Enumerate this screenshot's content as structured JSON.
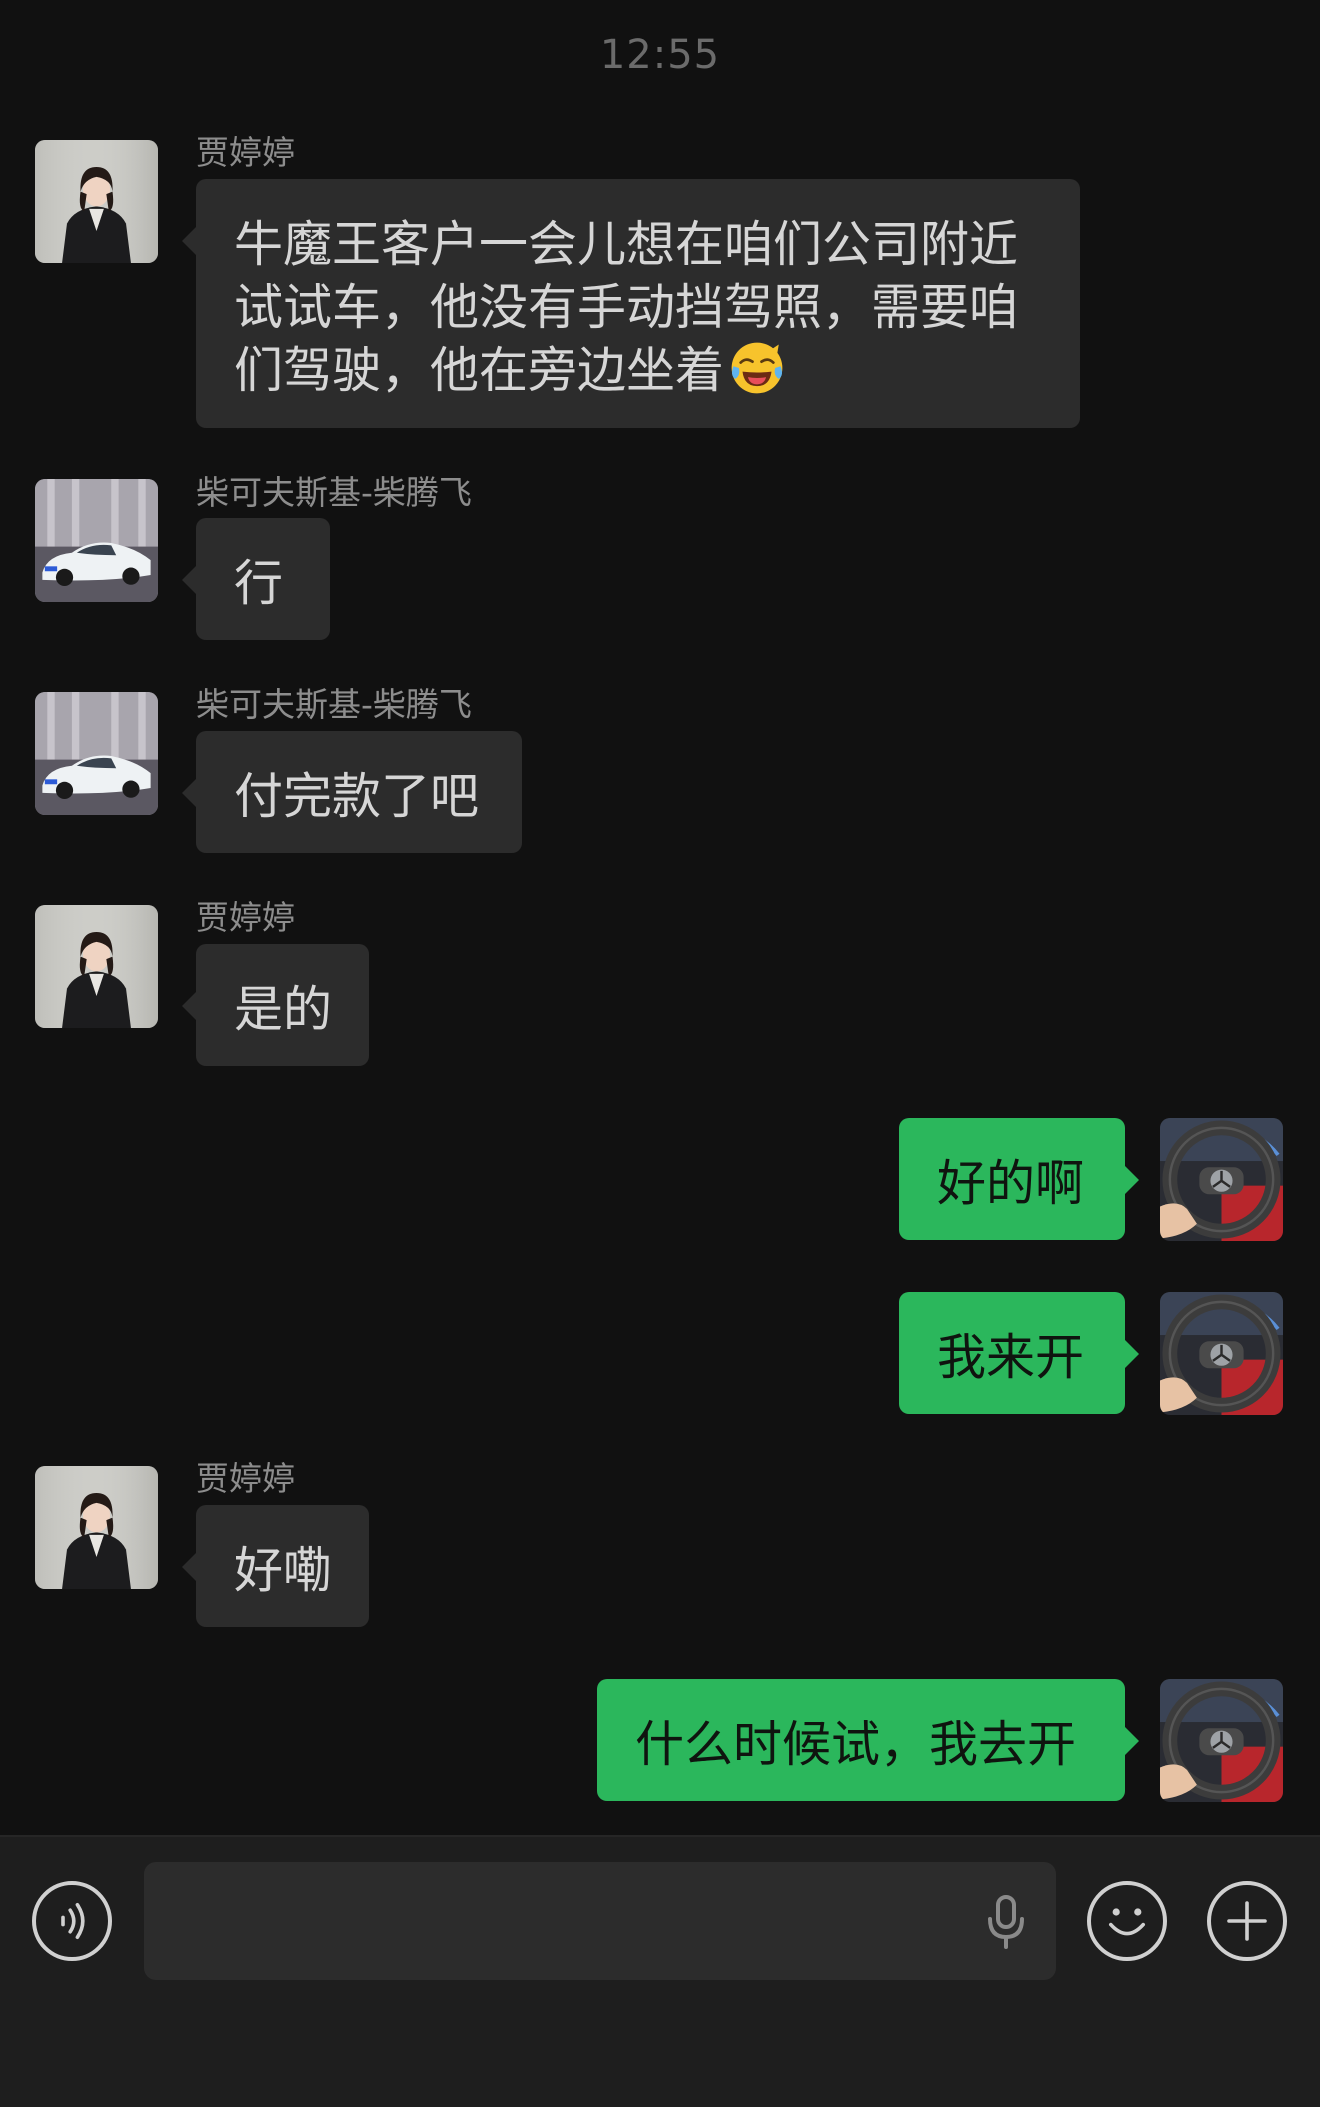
{
  "time": "12:55",
  "messages": [
    {
      "sender": "贾婷婷",
      "text": "牛魔王客户一会儿想在咱们公司附近试试车，他没有手动挡驾照，需要咱们驾驶，他在旁边坐着",
      "emoji": "face-with-tears-of-joy"
    },
    {
      "sender": "柴可夫斯基-柴腾飞",
      "text": "行"
    },
    {
      "sender": "柴可夫斯基-柴腾飞",
      "text": "付完款了吧"
    },
    {
      "sender": "贾婷婷",
      "text": "是的"
    },
    {
      "sender": "me",
      "text": "好的啊"
    },
    {
      "sender": "me",
      "text": "我来开"
    },
    {
      "sender": "贾婷婷",
      "text": "好嘞"
    },
    {
      "sender": "me",
      "text": "什么时候试，我去开"
    }
  ],
  "input": {
    "placeholder": ""
  },
  "icons": {
    "voice": "voice-toggle-icon",
    "mic": "microphone-icon",
    "emoji": "emoji-icon",
    "plus": "plus-icon"
  },
  "colors": {
    "background": "#111111",
    "incoming_bubble": "#2c2c2c",
    "outgoing_bubble": "#2bb75c",
    "bottom_bar": "#1e1e1e"
  }
}
